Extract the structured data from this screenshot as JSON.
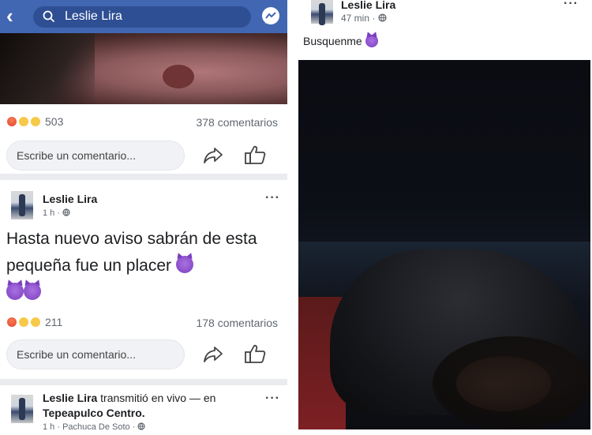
{
  "left": {
    "search": {
      "query": "Leslie Lira"
    },
    "post1": {
      "reactions_count": "503",
      "comments": "378 comentarios",
      "comment_placeholder": "Escribe un comentario..."
    },
    "post2": {
      "author": "Leslie Lira",
      "time": "1 h · ",
      "text": "Hasta nuevo aviso sabrán de esta pequeña fue un placer",
      "reactions_count": "211",
      "comments": "178 comentarios",
      "comment_placeholder": "Escribe un comentario..."
    },
    "post3": {
      "author": "Leslie Lira",
      "action": " transmitió en vivo — en",
      "place": "Tepeapulco Centro.",
      "meta": "1 h · Pachuca De Soto · "
    }
  },
  "right": {
    "post": {
      "author": "Leslie Lira",
      "time": "47 min · ",
      "text": "Busquenme",
      "more": "···"
    }
  },
  "icons": {
    "back": "chevron-left-icon",
    "search": "search-icon",
    "messenger": "messenger-icon",
    "share": "share-icon",
    "like": "like-icon",
    "globe": "globe-icon",
    "more": "more-dots-icon",
    "devil": "smiling-devil-emoji"
  },
  "colors": {
    "facebook_blue": "#4267b2",
    "search_bg": "#2f4f94",
    "feed_bg": "#e9ebee",
    "devil_purple": "#7b3fbf"
  }
}
